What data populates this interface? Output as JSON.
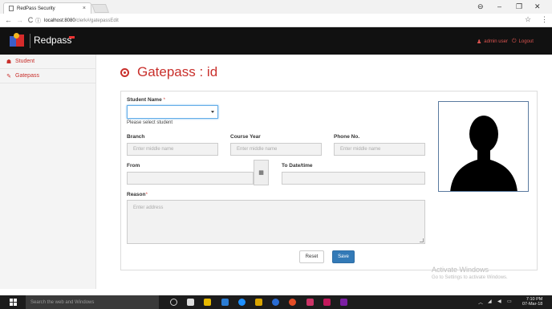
{
  "browser": {
    "tab_title": "RedPass Security",
    "tab_close": "×",
    "url_host": "localhost:8080",
    "url_path": "/clerk#/gatepassEdit",
    "window_controls": [
      "⊖",
      "–",
      "❐",
      "✕"
    ]
  },
  "app": {
    "brand": "Redpass",
    "header_links": [
      {
        "label": "admin user",
        "icon": "user-icon"
      },
      {
        "label": "Logout",
        "icon": "power-icon"
      }
    ]
  },
  "sidebar": {
    "items": [
      {
        "label": "Student",
        "icon": "users-icon"
      },
      {
        "label": "Gatepass",
        "icon": "edit-icon"
      }
    ]
  },
  "page": {
    "title": "Gatepass : id"
  },
  "form": {
    "student_name_label": "Student Name",
    "required_mark": "*",
    "student_select_value": "",
    "student_help": "Please select student",
    "branch_label": "Branch",
    "branch_placeholder": "Enter middle name",
    "course_year_label": "Course Year",
    "course_year_placeholder": "Enter middle name",
    "phone_label": "Phone No.",
    "phone_placeholder": "Enter middle name",
    "from_label": "From",
    "from_value": "",
    "to_label": "To Date/time",
    "to_value": "",
    "reason_label": "Reason",
    "reason_placeholder": "Enter address",
    "reset_label": "Reset",
    "save_label": "Save"
  },
  "watermark": {
    "line1": "Activate Windows",
    "line2": "Go to Settings to activate Windows."
  },
  "taskbar": {
    "search_placeholder": "Search the web and Windows",
    "time": "7:10 PM",
    "date": "07-Mar-18"
  },
  "colors": {
    "accent_red": "#c9302c",
    "primary_blue": "#337ab7",
    "header_bg": "#111111"
  }
}
